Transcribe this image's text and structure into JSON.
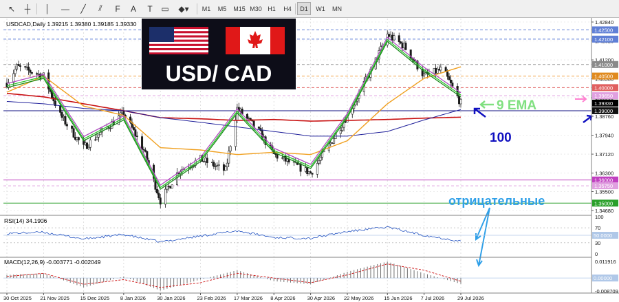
{
  "toolbar": {
    "tools": [
      {
        "name": "cursor-icon",
        "glyph": "↖"
      },
      {
        "name": "crosshair-icon",
        "glyph": "┼"
      },
      {
        "name": "vertical-line-icon",
        "glyph": "│"
      },
      {
        "name": "horizontal-line-icon",
        "glyph": "—"
      },
      {
        "name": "trendline-icon",
        "glyph": "╱"
      },
      {
        "name": "equidistant-channel-icon",
        "glyph": "⫽"
      },
      {
        "name": "fibonacci-icon",
        "glyph": "F"
      },
      {
        "name": "text-tool-icon",
        "glyph": "A"
      },
      {
        "name": "text-label-icon",
        "glyph": "T"
      },
      {
        "name": "rectangle-label-icon",
        "glyph": "▭"
      },
      {
        "name": "shapes-dropdown-icon",
        "glyph": "◆▾"
      }
    ],
    "timeframes": [
      "M1",
      "M5",
      "M15",
      "M30",
      "H1",
      "H4",
      "D1",
      "W1",
      "MN"
    ],
    "active_timeframe": "D1"
  },
  "chart": {
    "title": "USDCAD,Daily  1.39215 1.39380 1.39185 1.39330",
    "banner_text": "USD/ CAD",
    "annotations": {
      "ema_label": "9 EMA",
      "ma_label": "100",
      "negative_label": "отрицательные"
    },
    "price_axis": {
      "ticks": [
        "1.42840",
        "1.42020",
        "1.41200",
        "1.40380",
        "1.39560",
        "1.38760",
        "1.37940",
        "1.37120",
        "1.36300",
        "1.35500",
        "1.34680"
      ],
      "tags": [
        {
          "value": "1.42500",
          "color": "#5f7fd6"
        },
        {
          "value": "1.42100",
          "color": "#5f7fd6"
        },
        {
          "value": "1.41000",
          "color": "#8a8a8a"
        },
        {
          "value": "1.40500",
          "color": "#e08a1e"
        },
        {
          "value": "1.40000",
          "color": "#e06060"
        },
        {
          "value": "1.39650",
          "color": "#e0a0e0"
        },
        {
          "value": "1.39330",
          "color": "#000000"
        },
        {
          "value": "1.39000",
          "color": "#101010"
        },
        {
          "value": "1.36000",
          "color": "#c040c0"
        },
        {
          "value": "1.35750",
          "color": "#e0a0e0"
        },
        {
          "value": "1.35000",
          "color": "#2aa02a"
        }
      ]
    },
    "price_levels": [
      {
        "price": 1.425,
        "color": "#5f7fd6",
        "style": "dashed"
      },
      {
        "price": 1.421,
        "color": "#5f7fd6",
        "style": "dashed"
      },
      {
        "price": 1.41,
        "color": "#9a9a9a",
        "style": "dashed"
      },
      {
        "price": 1.405,
        "color": "#f0a040",
        "style": "dashed"
      },
      {
        "price": 1.4,
        "color": "#e06060",
        "style": "dashed"
      },
      {
        "price": 1.3965,
        "color": "#e0a0e0",
        "style": "dashed"
      },
      {
        "price": 1.39,
        "color": "#101080",
        "style": "solid"
      },
      {
        "price": 1.36,
        "color": "#c040c0",
        "style": "solid"
      },
      {
        "price": 1.3575,
        "color": "#e0a0e0",
        "style": "dashed"
      },
      {
        "price": 1.35,
        "color": "#2aa02a",
        "style": "solid"
      }
    ],
    "rsi": {
      "label": "RSI(14) 34.1906",
      "ticks": [
        "100",
        "70",
        "50.0000",
        "30",
        "0"
      ]
    },
    "macd": {
      "label": "MACD(12,26,9) -0.003771 -0.002049",
      "ticks": [
        "0.011916",
        "0.00000",
        "-0.008709"
      ]
    },
    "time_axis": [
      "30 Oct 2025",
      "21 Nov 2025",
      "15 Dec 2025",
      "8 Jan 2026",
      "30 Jan 2026",
      "23 Feb 2026",
      "17 Mar 2026",
      "8 Apr 2026",
      "30 Apr 2026",
      "22 May 2026",
      "15 Jun 2026",
      "7 Jul 2026",
      "29 Jul 2026"
    ],
    "colors": {
      "bull": "#1a1a1a",
      "bear": "#1a1a1a",
      "ema_fast": "#1e8c1e",
      "ema_mid": "#2ec42e",
      "ema_slow": "#b050c0",
      "ma_orange": "#f0a020",
      "ma_blue": "#20209a",
      "ma_red": "#c81010",
      "annotation_green": "#80e080",
      "annotation_blue": "#1010c0",
      "annotation_cyan": "#30a0e8"
    }
  },
  "chart_data": {
    "type": "candlestick",
    "title": "USDCAD,Daily  1.39215 1.39380 1.39185 1.39330",
    "x": [
      "30 Oct 2025",
      "21 Nov 2025",
      "15 Dec 2025",
      "8 Jan 2026",
      "30 Jan 2026",
      "23 Feb 2026",
      "17 Mar 2026",
      "8 Apr 2026",
      "30 Apr 2026",
      "22 May 2026",
      "15 Jun 2026",
      "7 Jul 2026",
      "29 Jul 2026"
    ],
    "ylim": [
      1.3468,
      1.4284
    ],
    "close_path": [
      {
        "date": "30 Oct 2025",
        "close": 1.402
      },
      {
        "date": "5 Nov 2025",
        "close": 1.409
      },
      {
        "date": "21 Nov 2025",
        "close": 1.405
      },
      {
        "date": "1 Dec 2025",
        "close": 1.388
      },
      {
        "date": "15 Dec 2025",
        "close": 1.374
      },
      {
        "date": "8 Jan 2026",
        "close": 1.389
      },
      {
        "date": "20 Jan 2026",
        "close": 1.373
      },
      {
        "date": "30 Jan 2026",
        "close": 1.351
      },
      {
        "date": "10 Feb 2026",
        "close": 1.364
      },
      {
        "date": "23 Feb 2026",
        "close": 1.369
      },
      {
        "date": "10 Mar 2026",
        "close": 1.364
      },
      {
        "date": "17 Mar 2026",
        "close": 1.391
      },
      {
        "date": "30 Mar 2026",
        "close": 1.381
      },
      {
        "date": "8 Apr 2026",
        "close": 1.371
      },
      {
        "date": "30 Apr 2026",
        "close": 1.363
      },
      {
        "date": "12 May 2026",
        "close": 1.376
      },
      {
        "date": "22 May 2026",
        "close": 1.388
      },
      {
        "date": "5 Jun 2026",
        "close": 1.407
      },
      {
        "date": "15 Jun 2026",
        "close": 1.423
      },
      {
        "date": "25 Jun 2026",
        "close": 1.418
      },
      {
        "date": "7 Jul 2026",
        "close": 1.405
      },
      {
        "date": "18 Jul 2026",
        "close": 1.408
      },
      {
        "date": "29 Jul 2026",
        "close": 1.3933
      }
    ],
    "ema_9": [
      {
        "date": "30 Oct 2025",
        "value": 1.4
      },
      {
        "date": "21 Nov 2025",
        "value": 1.404
      },
      {
        "date": "15 Dec 2025",
        "value": 1.377
      },
      {
        "date": "8 Jan 2026",
        "value": 1.386
      },
      {
        "date": "30 Jan 2026",
        "value": 1.356
      },
      {
        "date": "23 Feb 2026",
        "value": 1.368
      },
      {
        "date": "17 Mar 2026",
        "value": 1.389
      },
      {
        "date": "8 Apr 2026",
        "value": 1.372
      },
      {
        "date": "30 Apr 2026",
        "value": 1.365
      },
      {
        "date": "22 May 2026",
        "value": 1.387
      },
      {
        "date": "15 Jun 2026",
        "value": 1.42
      },
      {
        "date": "7 Jul 2026",
        "value": 1.407
      },
      {
        "date": "29 Jul 2026",
        "value": 1.396
      }
    ],
    "ma_100": [
      {
        "date": "30 Oct 2025",
        "value": 1.394
      },
      {
        "date": "21 Nov 2025",
        "value": 1.393
      },
      {
        "date": "15 Dec 2025",
        "value": 1.391
      },
      {
        "date": "8 Jan 2026",
        "value": 1.39
      },
      {
        "date": "30 Jan 2026",
        "value": 1.387
      },
      {
        "date": "23 Feb 2026",
        "value": 1.385
      },
      {
        "date": "17 Mar 2026",
        "value": 1.383
      },
      {
        "date": "8 Apr 2026",
        "value": 1.381
      },
      {
        "date": "30 Apr 2026",
        "value": 1.379
      },
      {
        "date": "22 May 2026",
        "value": 1.379
      },
      {
        "date": "15 Jun 2026",
        "value": 1.381
      },
      {
        "date": "7 Jul 2026",
        "value": 1.386
      },
      {
        "date": "29 Jul 2026",
        "value": 1.3905
      }
    ],
    "ma_orange": [
      {
        "date": "30 Oct 2025",
        "value": 1.398
      },
      {
        "date": "21 Nov 2025",
        "value": 1.405
      },
      {
        "date": "15 Dec 2025",
        "value": 1.392
      },
      {
        "date": "8 Jan 2026",
        "value": 1.388
      },
      {
        "date": "30 Jan 2026",
        "value": 1.374
      },
      {
        "date": "23 Feb 2026",
        "value": 1.373
      },
      {
        "date": "17 Mar 2026",
        "value": 1.371
      },
      {
        "date": "8 Apr 2026",
        "value": 1.372
      },
      {
        "date": "30 Apr 2026",
        "value": 1.371
      },
      {
        "date": "22 May 2026",
        "value": 1.377
      },
      {
        "date": "15 Jun 2026",
        "value": 1.393
      },
      {
        "date": "7 Jul 2026",
        "value": 1.404
      },
      {
        "date": "29 Jul 2026",
        "value": 1.409
      }
    ],
    "ma_red": [
      {
        "date": "30 Oct 2025",
        "value": 1.3975
      },
      {
        "date": "21 Nov 2025",
        "value": 1.396
      },
      {
        "date": "15 Dec 2025",
        "value": 1.393
      },
      {
        "date": "8 Jan 2026",
        "value": 1.39
      },
      {
        "date": "30 Jan 2026",
        "value": 1.387
      },
      {
        "date": "23 Feb 2026",
        "value": 1.3865
      },
      {
        "date": "17 Mar 2026",
        "value": 1.3858
      },
      {
        "date": "8 Apr 2026",
        "value": 1.3862
      },
      {
        "date": "30 Apr 2026",
        "value": 1.3855
      },
      {
        "date": "22 May 2026",
        "value": 1.3858
      },
      {
        "date": "15 Jun 2026",
        "value": 1.3862
      },
      {
        "date": "7 Jul 2026",
        "value": 1.3868
      },
      {
        "date": "29 Jul 2026",
        "value": 1.3872
      }
    ],
    "rsi_14": [
      {
        "date": "30 Oct 2025",
        "value": 55
      },
      {
        "date": "21 Nov 2025",
        "value": 58
      },
      {
        "date": "15 Dec 2025",
        "value": 40
      },
      {
        "date": "8 Jan 2026",
        "value": 52
      },
      {
        "date": "30 Jan 2026",
        "value": 32
      },
      {
        "date": "23 Feb 2026",
        "value": 48
      },
      {
        "date": "17 Mar 2026",
        "value": 62
      },
      {
        "date": "8 Apr 2026",
        "value": 44
      },
      {
        "date": "30 Apr 2026",
        "value": 42
      },
      {
        "date": "22 May 2026",
        "value": 60
      },
      {
        "date": "15 Jun 2026",
        "value": 72
      },
      {
        "date": "7 Jul 2026",
        "value": 50
      },
      {
        "date": "29 Jul 2026",
        "value": 34.19
      }
    ],
    "rsi_ylim": [
      0,
      100
    ],
    "macd_hist": [
      {
        "date": "30 Oct 2025",
        "value": 0.002
      },
      {
        "date": "21 Nov 2025",
        "value": 0.003
      },
      {
        "date": "15 Dec 2025",
        "value": -0.006
      },
      {
        "date": "8 Jan 2026",
        "value": 0.001
      },
      {
        "date": "30 Jan 2026",
        "value": -0.008
      },
      {
        "date": "23 Feb 2026",
        "value": -0.001
      },
      {
        "date": "17 Mar 2026",
        "value": 0.005
      },
      {
        "date": "8 Apr 2026",
        "value": -0.002
      },
      {
        "date": "30 Apr 2026",
        "value": -0.004
      },
      {
        "date": "22 May 2026",
        "value": 0.004
      },
      {
        "date": "15 Jun 2026",
        "value": 0.0105
      },
      {
        "date": "7 Jul 2026",
        "value": 0.003
      },
      {
        "date": "29 Jul 2026",
        "value": -0.003771
      }
    ],
    "macd_signal": [
      {
        "date": "30 Oct 2025",
        "value": 0.001
      },
      {
        "date": "21 Nov 2025",
        "value": 0.003
      },
      {
        "date": "15 Dec 2025",
        "value": -0.004
      },
      {
        "date": "8 Jan 2026",
        "value": -0.001
      },
      {
        "date": "30 Jan 2026",
        "value": -0.006
      },
      {
        "date": "23 Feb 2026",
        "value": -0.003
      },
      {
        "date": "17 Mar 2026",
        "value": 0.003
      },
      {
        "date": "8 Apr 2026",
        "value": 0.0
      },
      {
        "date": "30 Apr 2026",
        "value": -0.003
      },
      {
        "date": "22 May 2026",
        "value": 0.002
      },
      {
        "date": "15 Jun 2026",
        "value": 0.009
      },
      {
        "date": "7 Jul 2026",
        "value": 0.005
      },
      {
        "date": "29 Jul 2026",
        "value": -0.002049
      }
    ],
    "macd_ylim": [
      -0.008709,
      0.011916
    ]
  }
}
